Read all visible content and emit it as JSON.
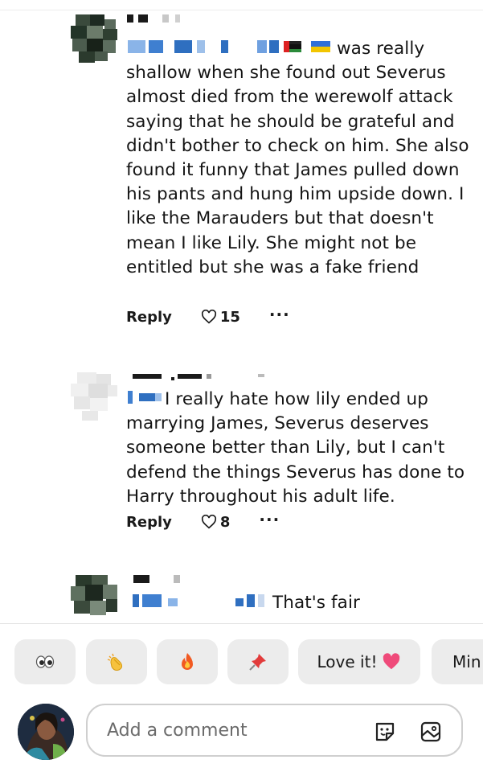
{
  "comments": [
    {
      "text": "was really shallow when she found out Severus almost died from the werewolf attack saying that he should be grateful and didn't bother to check on him. She also found it funny that James pulled down his pants and hung him upside down. I like the Marauders but that doesn't mean I like Lily. She might not be entitled but she was a fake friend",
      "reply_label": "Reply",
      "likes": "15",
      "more": "···"
    },
    {
      "text": "I really hate how lily ended up marrying James, Severus deserves someone better than Lily, but I can't defend the things Severus has done to Harry throughout his adult life.",
      "reply_label": "Reply",
      "likes": "8",
      "more": "···"
    },
    {
      "text": "That's fair"
    }
  ],
  "reactions": [
    {
      "icon": "eyes-icon"
    },
    {
      "icon": "clapping-hands-icon"
    },
    {
      "icon": "fire-icon"
    },
    {
      "icon": "pushpin-icon"
    },
    {
      "label": "Love it!",
      "icon": "pink-heart-icon"
    },
    {
      "label": "Min"
    }
  ],
  "composer": {
    "placeholder": "Add a comment",
    "icons": [
      "sticker-icon",
      "image-icon"
    ]
  },
  "colors": {
    "heart": "#ef4a7a",
    "chip_bg": "#ececec",
    "text": "#141414"
  }
}
